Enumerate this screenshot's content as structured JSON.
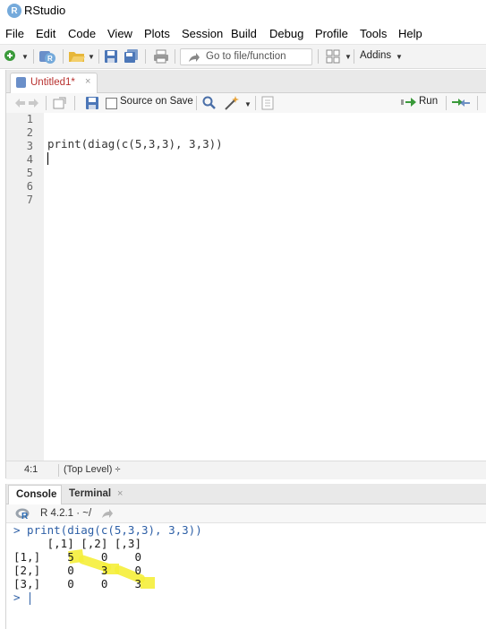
{
  "window": {
    "title": "RStudio",
    "logo_letter": "R"
  },
  "menu": [
    "File",
    "Edit",
    "Code",
    "View",
    "Plots",
    "Session",
    "Build",
    "Debug",
    "Profile",
    "Tools",
    "Help"
  ],
  "toolbar": {
    "goto_placeholder": "Go to file/function",
    "addins_label": "Addins"
  },
  "editor": {
    "tab_label": "Untitled1*",
    "tab_close": "×",
    "source_on_save_label": "Source on Save",
    "run_label": "Run",
    "line_numbers": [
      "1",
      "2",
      "3",
      "4",
      "5",
      "6",
      "7"
    ],
    "code_line_3": "print(diag(c(5,3,3), 3,3))",
    "cursor_position": "4:1",
    "scope": "(Top Level) ÷"
  },
  "console": {
    "tabs": [
      "Console",
      "Terminal"
    ],
    "terminal_close": "×",
    "r_version": "R 4.2.1 · ~/",
    "lines": [
      "> print(diag(c(5,3,3), 3,3))",
      "     [,1] [,2] [,3]",
      "[1,]    5    0    0",
      "[2,]    0    3    0",
      "[3,]    0    0    3",
      "> "
    ]
  },
  "colors": {
    "accent": "#75aadb",
    "modified_tab": "#b8312f",
    "console_input": "#2d5fa6",
    "highlight": "#f5ee3a",
    "run_arrow": "#3a9a3a"
  }
}
